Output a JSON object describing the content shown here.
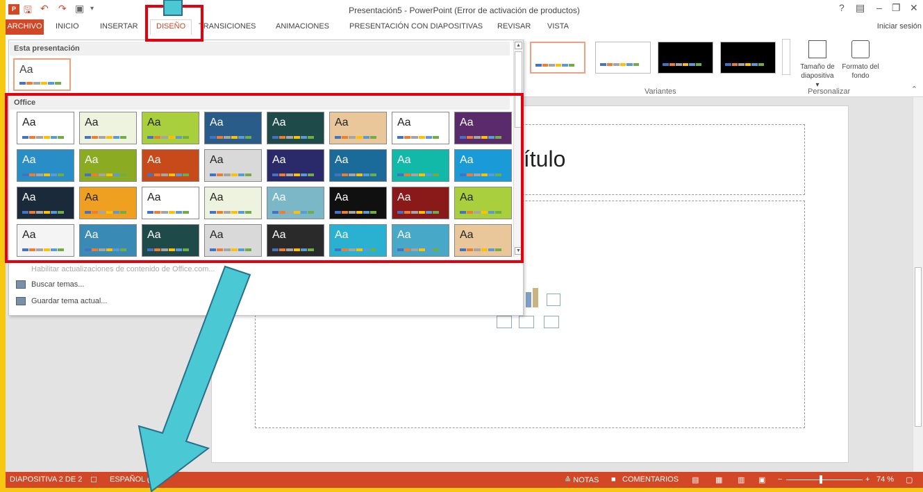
{
  "window": {
    "title": "Presentación5 - PowerPoint (Error de activación de productos)",
    "help": "?",
    "signin": "Iniciar sesión"
  },
  "tabs": [
    "ARCHIVO",
    "INICIO",
    "INSERTAR",
    "DISEÑO",
    "TRANSICIONES",
    "ANIMACIONES",
    "PRESENTACIÓN CON DIAPOSITIVAS",
    "REVISAR",
    "VISTA"
  ],
  "ribbon": {
    "variants_label": "Variantes",
    "personalizar_label": "Personalizar",
    "slide_size_label": "Tamaño de diapositiva ▾",
    "format_bg_label": "Formato del fondo"
  },
  "dropdown": {
    "this_presentation_header": "Esta presentación",
    "office_header": "Office",
    "aa": "Aa",
    "enable_updates": "Habilitar actualizaciones de contenido de Office.com...",
    "browse_themes": "Buscar temas...",
    "save_theme": "Guardar tema actual..."
  },
  "slide": {
    "title_fragment": "título"
  },
  "statusbar": {
    "slide_info": "DIAPOSITIVA 2 DE 2",
    "language": "ESPAÑOL (CH",
    "notes": "≙ NOTAS",
    "comments": "COMENTARIOS",
    "zoom": "74 %"
  },
  "colors": {
    "accent": "#d24726",
    "highlight": "#e3000f",
    "arrow": "#4ac8d4",
    "frame": "#f6c812"
  }
}
